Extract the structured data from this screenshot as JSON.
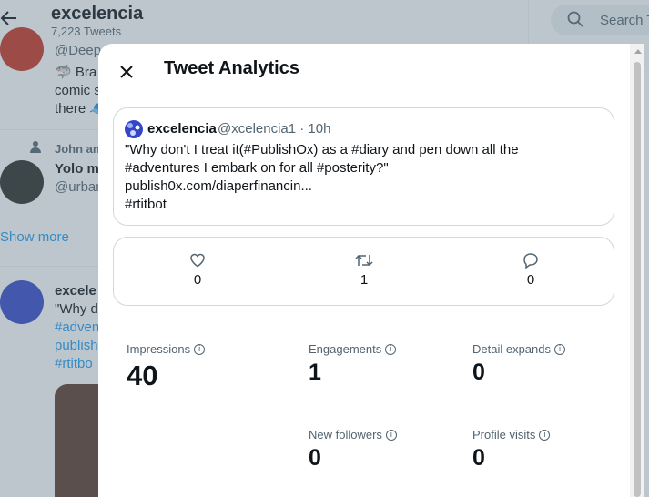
{
  "background": {
    "header": {
      "title": "excelencia",
      "tweet_count": "7,223 Tweets"
    },
    "search": {
      "placeholder": "Search T"
    },
    "items": [
      {
        "handle": "@Deepa",
        "line1": "🦈 Bra",
        "line2": "comic s",
        "line3": "there 🧢"
      },
      {
        "context": "John and",
        "name": "Yolo m",
        "handle": "@urban"
      },
      {
        "name": "excele",
        "line1": "\"Why d",
        "line2": "#adven",
        "line3": "publish",
        "line4": "#rtitbo"
      }
    ],
    "show_more": "Show more"
  },
  "modal": {
    "title": "Tweet Analytics",
    "tweet": {
      "name": "excelencia",
      "handle_time": "@xcelencia1 · 10h",
      "lines": [
        "\"Why don't I treat it(#PublishOx) as a #diary and pen down all the",
        "#adventures I embark on for all #posterity?\"",
        "publish0x.com/diaperfinancin...",
        "#rtitbot"
      ]
    },
    "stats": {
      "likes": "0",
      "retweets": "1",
      "replies": "0"
    },
    "metrics": {
      "impressions": {
        "label": "Impressions",
        "value": "40"
      },
      "engagements": {
        "label": "Engagements",
        "value": "1"
      },
      "detail_expands": {
        "label": "Detail expands",
        "value": "0"
      },
      "new_followers": {
        "label": "New followers",
        "value": "0"
      },
      "profile_visits": {
        "label": "Profile visits",
        "value": "0"
      }
    }
  },
  "colors": {
    "accent": "#1d9bf0",
    "text": "#0f1419",
    "muted": "#536471",
    "border": "#cfd9de"
  },
  "icons": [
    "back-arrow-icon",
    "search-icon",
    "close-icon",
    "heart-icon",
    "retweet-icon",
    "reply-icon",
    "info-icon",
    "person-icon"
  ]
}
